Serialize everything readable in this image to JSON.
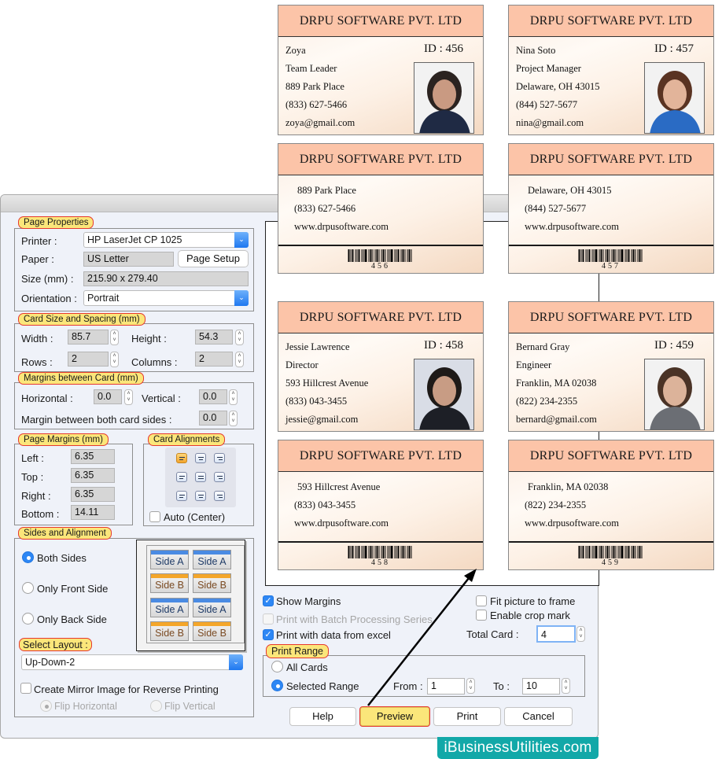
{
  "page_properties": {
    "legend": "Page Properties",
    "printer_label": "Printer :",
    "printer_value": "HP LaserJet CP 1025",
    "paper_label": "Paper :",
    "paper_value": "US Letter",
    "page_setup_label": "Page Setup",
    "size_label": "Size (mm) :",
    "size_value": "215.90 x 279.40",
    "orientation_label": "Orientation :",
    "orientation_value": "Portrait"
  },
  "card_size": {
    "legend": "Card Size and Spacing (mm)",
    "width_label": "Width :",
    "width_value": "85.7",
    "height_label": "Height :",
    "height_value": "54.3",
    "rows_label": "Rows :",
    "rows_value": "2",
    "columns_label": "Columns :",
    "columns_value": "2"
  },
  "margins_between": {
    "legend": "Margins between Card (mm)",
    "horizontal_label": "Horizontal :",
    "horizontal_value": "0.0",
    "vertical_label": "Vertical :",
    "vertical_value": "0.0",
    "both_sides_label": "Margin between both card sides :",
    "both_sides_value": "0.0"
  },
  "page_margins": {
    "legend": "Page Margins (mm)",
    "left_label": "Left :",
    "left_value": "6.35",
    "top_label": "Top :",
    "top_value": "6.35",
    "right_label": "Right :",
    "right_value": "6.35",
    "bottom_label": "Bottom :",
    "bottom_value": "14.11"
  },
  "card_alignments": {
    "legend": "Card Alignments",
    "selected": "top-left",
    "auto_center_label": "Auto (Center)"
  },
  "sides": {
    "legend": "Sides and Alignment",
    "both_sides_label": "Both Sides",
    "front_only_label": "Only Front Side",
    "back_only_label": "Only Back Side",
    "selected": "both",
    "tiles": [
      "Side A",
      "Side A",
      "Side B",
      "Side B",
      "Side A",
      "Side A",
      "Side B",
      "Side B"
    ],
    "select_layout_label": "Select Layout :",
    "layout_value": "Up-Down-2",
    "mirror_label": "Create Mirror Image for Reverse Printing",
    "flip_h_label": "Flip Horizontal",
    "flip_v_label": "Flip Vertical"
  },
  "options": {
    "show_margins_label": "Show Margins",
    "show_margins": true,
    "batch_label": "Print with Batch Processing Series",
    "excel_label": "Print with data from excel",
    "excel": true,
    "fit_picture_label": "Fit picture to frame",
    "crop_mark_label": "Enable crop mark",
    "total_card_label": "Total Card :",
    "total_card_value": "4"
  },
  "print_range": {
    "legend": "Print Range",
    "all_label": "All Cards",
    "selected_label": "Selected Range",
    "from_label": "From :",
    "from_value": "1",
    "to_label": "To :",
    "to_value": "10"
  },
  "buttons": {
    "help": "Help",
    "preview": "Preview",
    "print": "Print",
    "cancel": "Cancel"
  },
  "brand": "iBusinessUtilities.com",
  "colors": {
    "legend_fill": "#fbe67a",
    "legend_border": "#e6392f",
    "accent_blue": "#2d87f5",
    "card_header": "#fcc4a8",
    "brand_teal": "#12a8a8"
  },
  "cards": {
    "company": "DRPU SOFTWARE PVT. LTD",
    "id_prefix": "ID :",
    "website": "www.drpusoftware.com",
    "front": [
      {
        "id": "456",
        "name": "Zoya",
        "title": "Team Leader",
        "address": "889 Park Place",
        "phone": "(833) 627-5466",
        "email": "zoya@gmail.com"
      },
      {
        "id": "457",
        "name": "Nina Soto",
        "title": "Project Manager",
        "address": "Delaware, OH 43015",
        "phone": "(844) 527-5677",
        "email": "nina@gmail.com"
      },
      {
        "id": "458",
        "name": "Jessie Lawrence",
        "title": "Director",
        "address": "593 Hillcrest Avenue",
        "phone": "(833) 043-3455",
        "email": "jessie@gmail.com"
      },
      {
        "id": "459",
        "name": "Bernard Gray",
        "title": "Engineer",
        "address": "Franklin, MA 02038",
        "phone": "(822) 234-2355",
        "email": "bernard@gmail.com"
      }
    ],
    "back": [
      {
        "address": "889 Park Place",
        "phone": "(833) 627-5466",
        "barcode": "456"
      },
      {
        "address": "Delaware, OH 43015",
        "phone": "(844) 527-5677",
        "barcode": "457"
      },
      {
        "address": "593 Hillcrest Avenue",
        "phone": "(833) 043-3455",
        "barcode": "458"
      },
      {
        "address": "Franklin, MA 02038",
        "phone": "(822) 234-2355",
        "barcode": "459"
      }
    ]
  }
}
